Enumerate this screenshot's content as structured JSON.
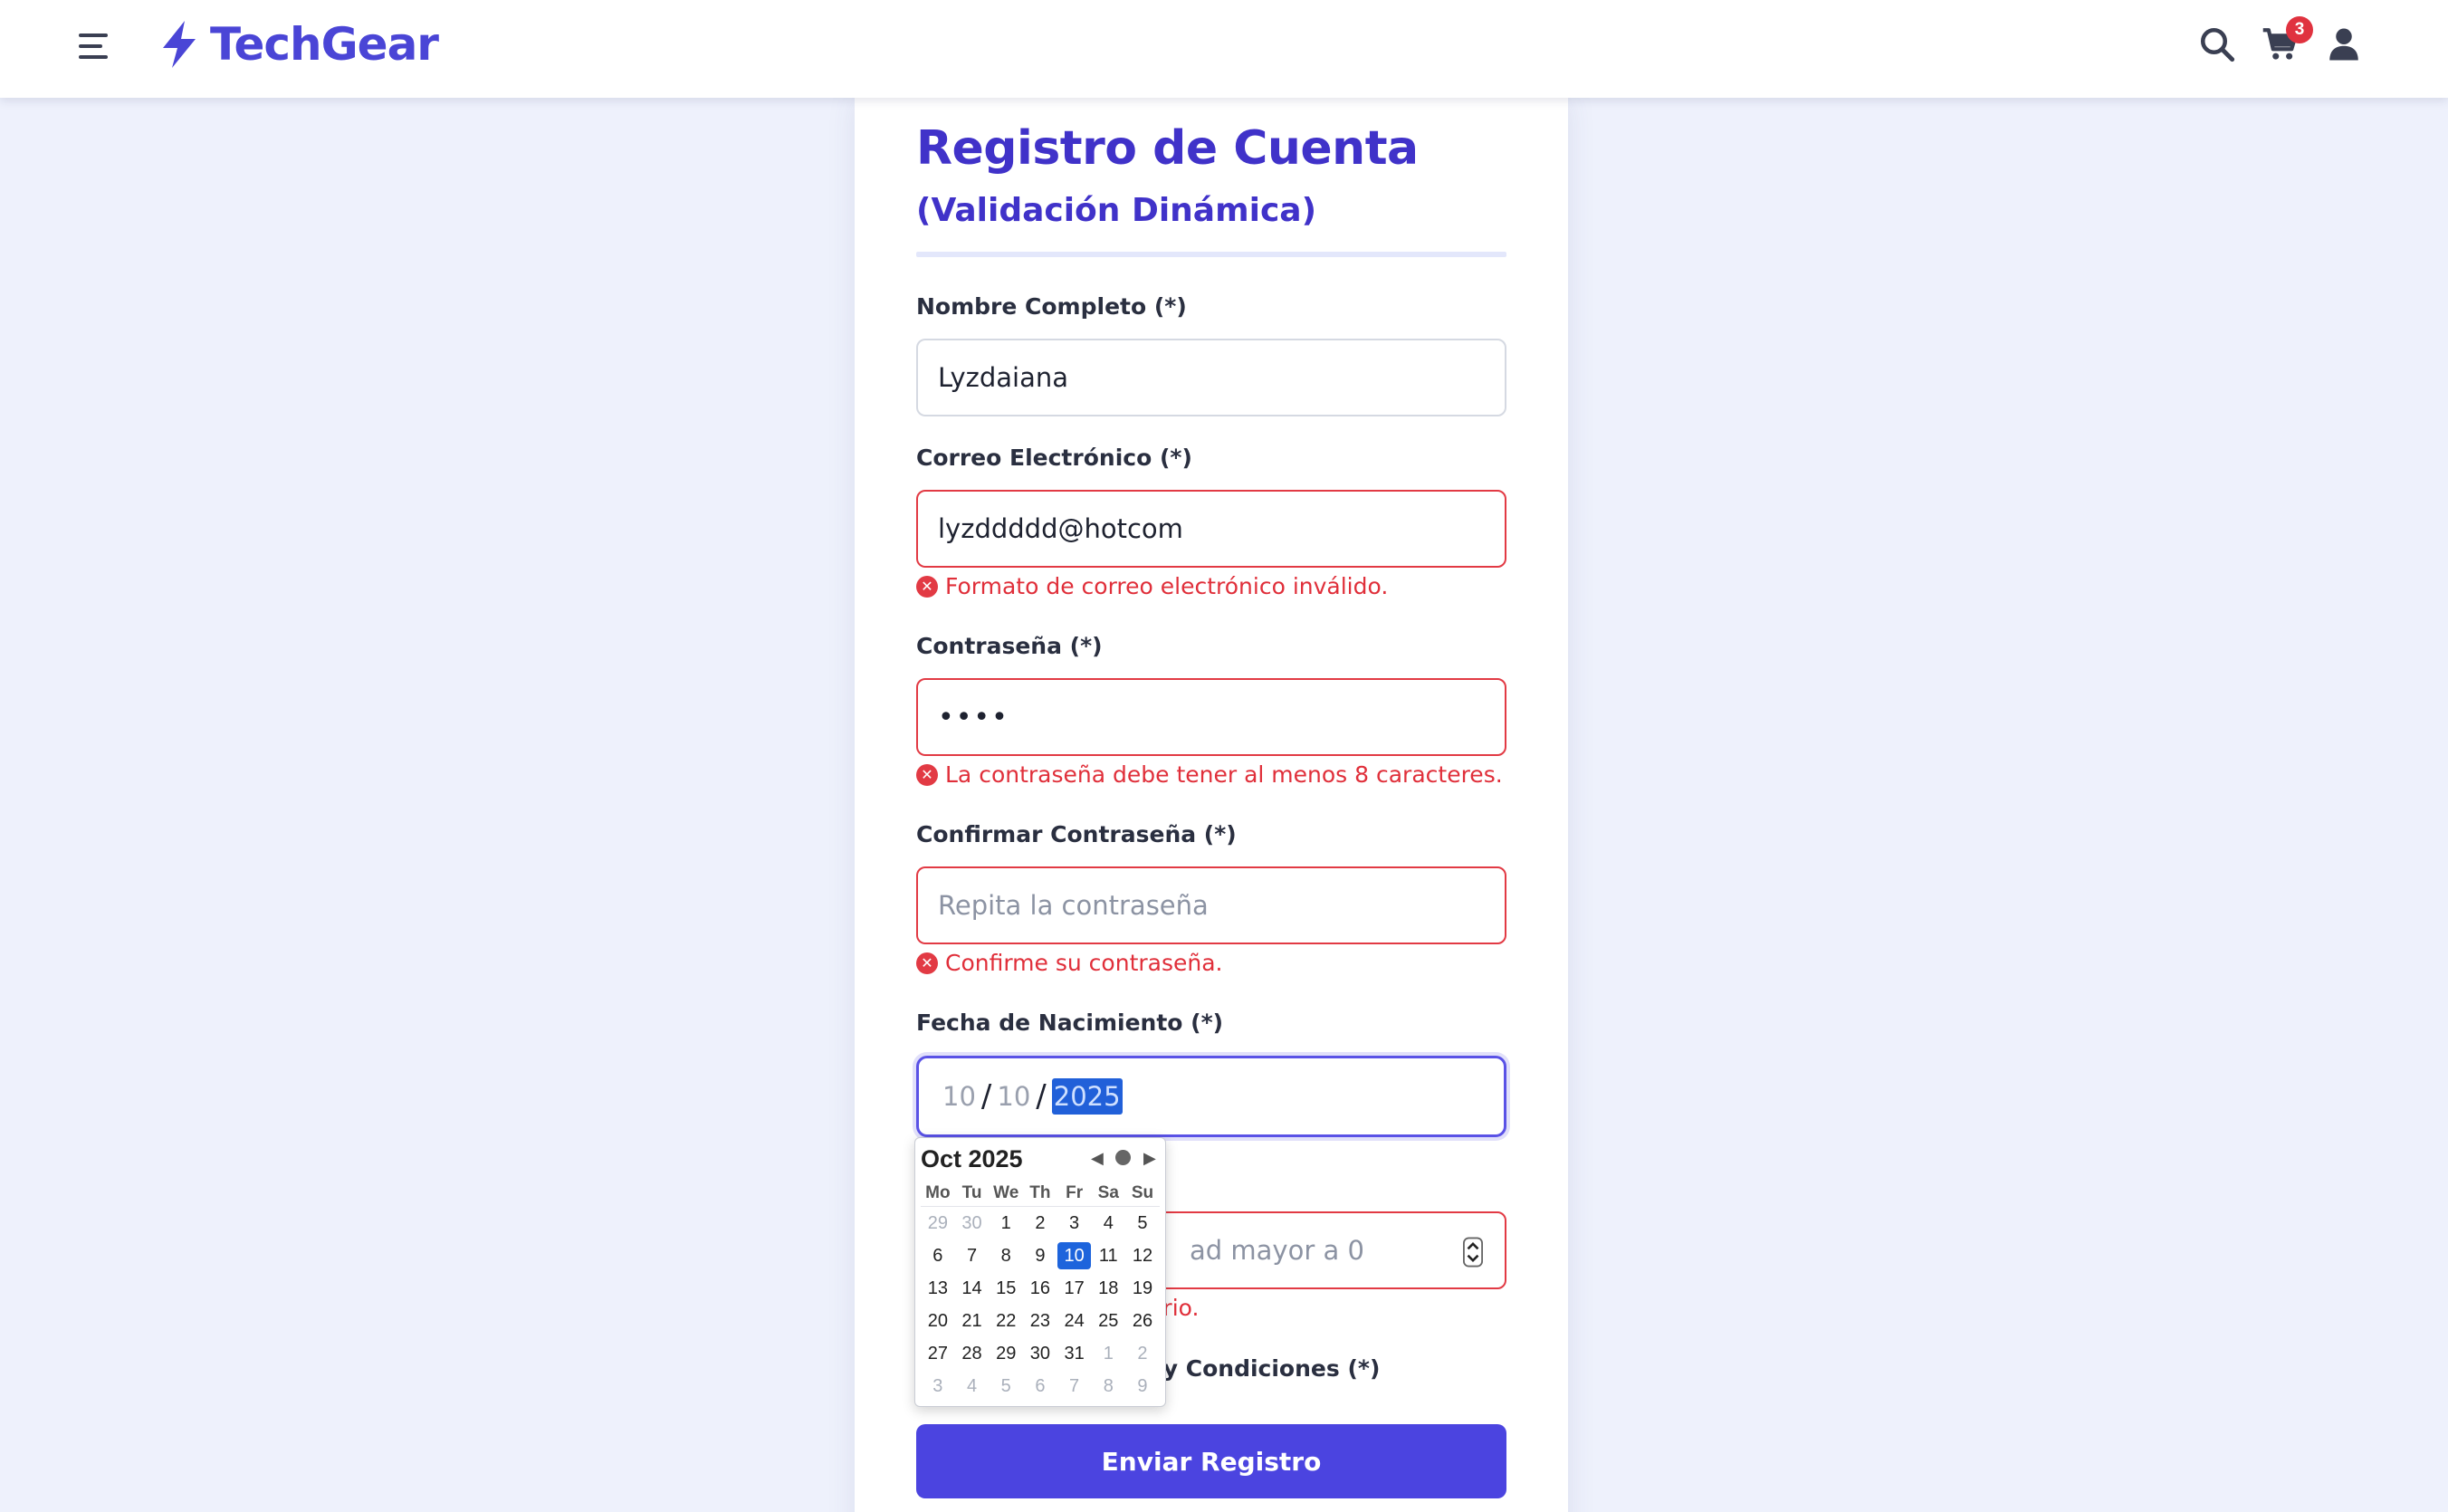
{
  "header": {
    "brand": "TechGear",
    "cart_count": "3",
    "icons": [
      "menu-icon",
      "bolt-icon",
      "search-icon",
      "cart-icon",
      "user-icon"
    ]
  },
  "form": {
    "title": "Registro de Cuenta",
    "subtitle": "(Validación Dinámica)",
    "name": {
      "label": "Nombre Completo (*)",
      "value": "Lyzdaiana"
    },
    "email": {
      "label": "Correo Electrónico (*)",
      "value": "lyzddddd@hotcom",
      "error": "Formato de correo electrónico inválido."
    },
    "password": {
      "label": "Contraseña (*)",
      "masked": "••••",
      "error": "La contraseña debe tener al menos 8 caracteres."
    },
    "confirm": {
      "label": "Confirmar Contraseña (*)",
      "placeholder": "Repita la contraseña",
      "error": "Confirme su contraseña."
    },
    "birthdate": {
      "label": "Fecha de Nacimiento (*)",
      "month": "10",
      "day": "10",
      "year": "2025"
    },
    "age": {
      "placeholder_visible": "ad mayor a 0",
      "error_visible": "atorio."
    },
    "terms_visible": "os y Condiciones (*)",
    "submit": "Enviar Registro"
  },
  "calendar": {
    "month_label": "Oct 2025",
    "weekdays": [
      "Mo",
      "Tu",
      "We",
      "Th",
      "Fr",
      "Sa",
      "Su"
    ],
    "weeks": [
      [
        {
          "d": "29",
          "m": true
        },
        {
          "d": "30",
          "m": true
        },
        {
          "d": "1"
        },
        {
          "d": "2"
        },
        {
          "d": "3"
        },
        {
          "d": "4"
        },
        {
          "d": "5"
        }
      ],
      [
        {
          "d": "6"
        },
        {
          "d": "7"
        },
        {
          "d": "8"
        },
        {
          "d": "9"
        },
        {
          "d": "10",
          "s": true
        },
        {
          "d": "11"
        },
        {
          "d": "12"
        }
      ],
      [
        {
          "d": "13"
        },
        {
          "d": "14"
        },
        {
          "d": "15"
        },
        {
          "d": "16"
        },
        {
          "d": "17"
        },
        {
          "d": "18"
        },
        {
          "d": "19"
        }
      ],
      [
        {
          "d": "20"
        },
        {
          "d": "21"
        },
        {
          "d": "22"
        },
        {
          "d": "23"
        },
        {
          "d": "24"
        },
        {
          "d": "25"
        },
        {
          "d": "26"
        }
      ],
      [
        {
          "d": "27"
        },
        {
          "d": "28"
        },
        {
          "d": "29"
        },
        {
          "d": "30"
        },
        {
          "d": "31"
        },
        {
          "d": "1",
          "m": true
        },
        {
          "d": "2",
          "m": true
        }
      ],
      [
        {
          "d": "3",
          "m": true
        },
        {
          "d": "4",
          "m": true
        },
        {
          "d": "5",
          "m": true
        },
        {
          "d": "6",
          "m": true
        },
        {
          "d": "7",
          "m": true
        },
        {
          "d": "8",
          "m": true
        },
        {
          "d": "9",
          "m": true
        }
      ]
    ],
    "colors": {
      "selected": "#1d64dc",
      "muted": "#aab0bb"
    }
  },
  "colors": {
    "brand": "#4a45d6",
    "title": "#4032c9",
    "error": "#e02f3a",
    "button": "#4b44e0",
    "focus": "#5a52e6"
  }
}
